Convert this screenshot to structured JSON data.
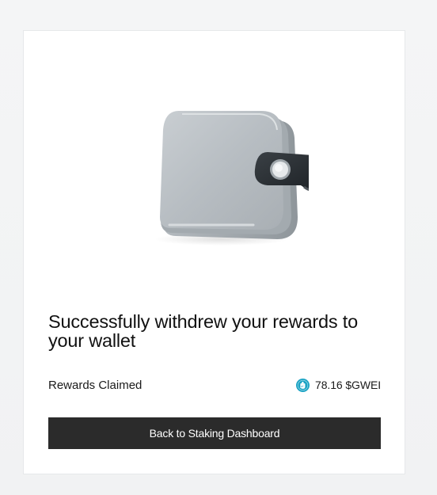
{
  "dialog": {
    "title": "Successfully withdrew your rewards to your wallet",
    "illustration": "wallet-icon"
  },
  "reward": {
    "label": "Rewards Claimed",
    "token_icon": "gwei-token-icon",
    "token_color": "#1aa3c4",
    "amount": "78.16 $GWEI"
  },
  "actions": {
    "back_label": "Back to Staking Dashboard",
    "back_color": "#2b2b2b"
  }
}
